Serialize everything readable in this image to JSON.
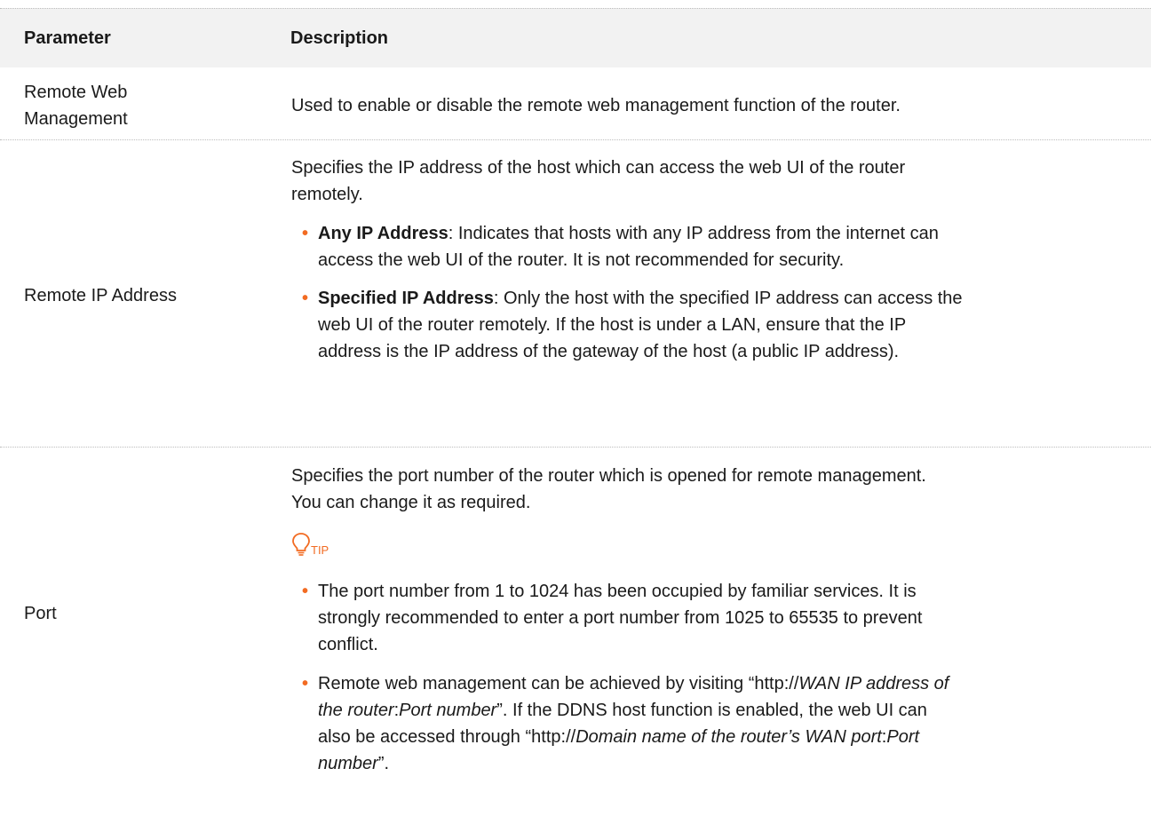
{
  "header": {
    "parameter": "Parameter",
    "description": "Description"
  },
  "rows": [
    {
      "param_line1": "Remote Web",
      "param_line2": "Management",
      "desc": "Used to enable or disable the remote web management function of the router."
    },
    {
      "param": "Remote IP Address",
      "intro_line1": "Specifies the IP address of the host which can access the web UI of the router",
      "intro_line2": "remotely.",
      "bullet1_bold": "Any IP Address",
      "bullet1_line1": ": Indicates that hosts with any IP address from the internet can",
      "bullet1_line2": "access the web UI of the router. It is not recommended for security.",
      "bullet2_bold": "Specified IP Address",
      "bullet2_line1": ": Only the host with the specified IP address can access the",
      "bullet2_line2": "web UI of the router remotely. If the host is under a LAN, ensure that the IP",
      "bullet2_line3": "address is the IP address of the gateway of the host (a public IP address)."
    },
    {
      "param": "Port",
      "intro_line1": "Specifies the port number of the router which is opened for remote management.",
      "intro_line2": "You can change it as required.",
      "tip_label": "TIP",
      "bullet1_line1": "The port number from 1 to 1024 has been occupied by familiar services. It is",
      "bullet1_line2": "strongly recommended to enter a port number from 1025 to 65535 to prevent",
      "bullet1_line3": "conflict.",
      "b2_a": "Remote web management can be achieved by visiting “http://",
      "b2_b": "WAN IP address of",
      "b2_c": "the router",
      "b2_d": ":",
      "b2_e": "Port number",
      "b2_f": "”. If the DDNS host function is enabled, the web UI can",
      "b2_g": "also be accessed through “http://",
      "b2_h": "Domain name of the router’s WAN port",
      "b2_i": ":",
      "b2_j": "Port",
      "b2_k": "number",
      "b2_l": "”."
    }
  ],
  "colors": {
    "accent": "#f26b22",
    "header_bg": "#f2f2f2"
  },
  "icons": {
    "tip": "lightbulb-icon"
  }
}
